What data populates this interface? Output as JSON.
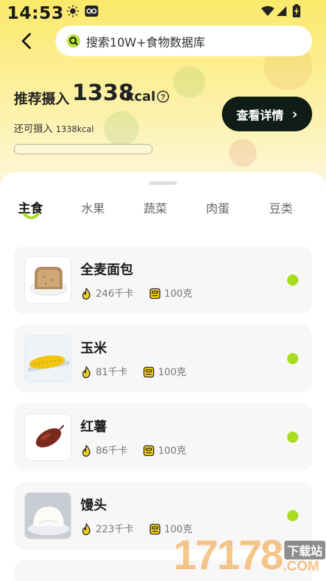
{
  "status_bar": {
    "time": "14:53"
  },
  "search": {
    "placeholder": "搜索10W+食物数据库"
  },
  "summary": {
    "recommended_label": "推荐摄入",
    "recommended_value": "1338",
    "recommended_unit": "kcal",
    "remaining_label": "还可摄入",
    "remaining_value": "1338kcal",
    "progress_fraction": 0,
    "detail_button_label": "查看详情",
    "detail_button_arrow": "›"
  },
  "tabs": [
    {
      "label": "主食",
      "active": true
    },
    {
      "label": "水果",
      "active": false
    },
    {
      "label": "蔬菜",
      "active": false
    },
    {
      "label": "肉蛋",
      "active": false
    },
    {
      "label": "豆类",
      "active": false
    }
  ],
  "foods": [
    {
      "name": "全麦面包",
      "calories": "246千卡",
      "portion": "100克",
      "icon": "bread"
    },
    {
      "name": "玉米",
      "calories": "81千卡",
      "portion": "100克",
      "icon": "corn"
    },
    {
      "name": "红薯",
      "calories": "86千卡",
      "portion": "100克",
      "icon": "sweet-potato"
    },
    {
      "name": "馒头",
      "calories": "223千卡",
      "portion": "100克",
      "icon": "steamed-bun"
    }
  ],
  "watermark": {
    "number": "17178",
    "site": "下载站",
    "domain": ".COM"
  },
  "colors": {
    "accent_green": "#a8dc1e",
    "button_dark": "#0f1d16",
    "header_yellow": "#fbe96a"
  }
}
